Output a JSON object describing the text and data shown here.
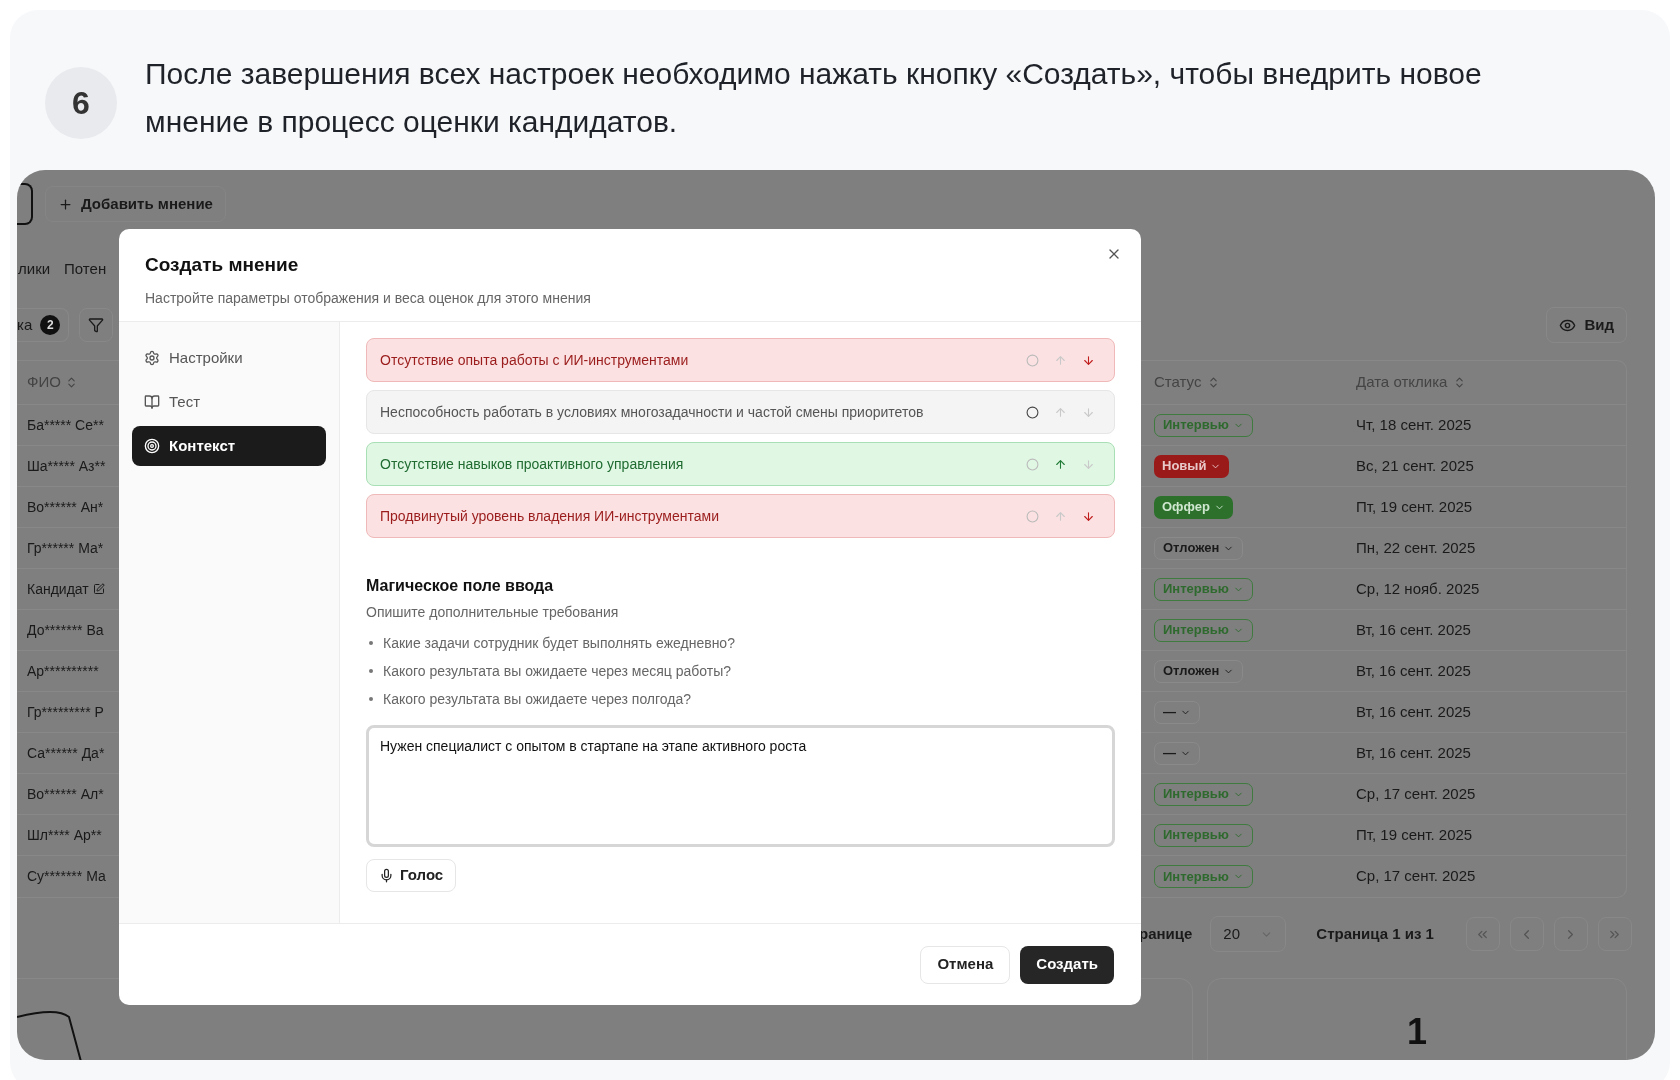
{
  "step": {
    "number": "6",
    "text": "После завершения всех настроек необходимо нажать кнопку «Создать», чтобы внедрить новое мнение в процесс оценки кандидатов."
  },
  "app": {
    "add_button": "Добавить мнение",
    "tabs": [
      {
        "label": "лики",
        "selected": false
      },
      {
        "label": "Потен",
        "selected": false
      }
    ],
    "filter_label": "ка",
    "filter_count": "2",
    "view_button": "Вид",
    "table": {
      "columns": [
        "ФИО",
        "Статус",
        "Дата отклика"
      ],
      "rows": [
        {
          "name": "Ба***** Се**",
          "status": "Интервью",
          "kind": "interview",
          "date": "Чт, 18 сент. 2025"
        },
        {
          "name": "Ша***** Аз**",
          "status": "Новый",
          "kind": "new",
          "date": "Вс, 21 сент. 2025"
        },
        {
          "name": "Во****** Ан*",
          "status": "Оффер",
          "kind": "offer",
          "date": "Пт, 19 сент. 2025"
        },
        {
          "name": "Гр****** Ма*",
          "status": "Отложен",
          "kind": "postponed",
          "date": "Пн, 22 сент. 2025"
        },
        {
          "name": "Кандидат",
          "edit": true,
          "status": "Интервью",
          "kind": "interview",
          "date": "Ср, 12 нояб. 2025"
        },
        {
          "name": "До******* Ва",
          "status": "Интервью",
          "kind": "interview",
          "date": "Вт, 16 сент. 2025"
        },
        {
          "name": "Ар**********",
          "status": "Отложен",
          "kind": "postponed",
          "date": "Вт, 16 сент. 2025"
        },
        {
          "name": "Гр********* Р",
          "status": "—",
          "kind": "none",
          "date": "Вт, 16 сент. 2025"
        },
        {
          "name": "Са****** Да*",
          "status": "—",
          "kind": "none",
          "date": "Вт, 16 сент. 2025"
        },
        {
          "name": "Во****** Ал*",
          "status": "Интервью",
          "kind": "interview",
          "date": "Ср, 17 сент. 2025"
        },
        {
          "name": "Шл**** Ар**",
          "status": "Интервью",
          "kind": "interview",
          "date": "Пт, 19 сент. 2025"
        },
        {
          "name": "Су******* Ма",
          "status": "Интервью",
          "kind": "interview",
          "date": "Ср, 17 сент. 2025"
        }
      ]
    },
    "pagination": {
      "per_page_label": "ранице",
      "per_page": "20",
      "page": "Страница 1 из 1"
    },
    "summary_value": "1"
  },
  "dialog": {
    "title": "Создать мнение",
    "subtitle": "Настройте параметры отображения и веса оценок для этого мнения",
    "nav": [
      {
        "label": "Настройки",
        "selected": false
      },
      {
        "label": "Тест",
        "selected": false
      },
      {
        "label": "Контекст",
        "selected": true
      }
    ],
    "criteria": [
      {
        "text": "Отсутствие опыта работы с ИИ-инструментами",
        "kind": "negative"
      },
      {
        "text": "Неспособность работать в условиях многозадачности и частой смены приоритетов",
        "kind": "neutral"
      },
      {
        "text": "Отсутствие навыков проактивного управления",
        "kind": "positive"
      },
      {
        "text": "Продвинутый уровень владения ИИ-инструментами",
        "kind": "negative"
      }
    ],
    "magic": {
      "title": "Магическое поле ввода",
      "subtitle": "Опишите дополнительные требования",
      "hints": [
        "Какие задачи сотрудник будет выполнять ежедневно?",
        "Какого результата вы ожидаете через месяц работы?",
        "Какого результата вы ожидаете через полгода?"
      ],
      "value": "Нужен специалист с опытом в стартапе на этапе активного роста",
      "voice_button": "Голос"
    },
    "cancel_button": "Отмена",
    "create_button": "Создать"
  }
}
